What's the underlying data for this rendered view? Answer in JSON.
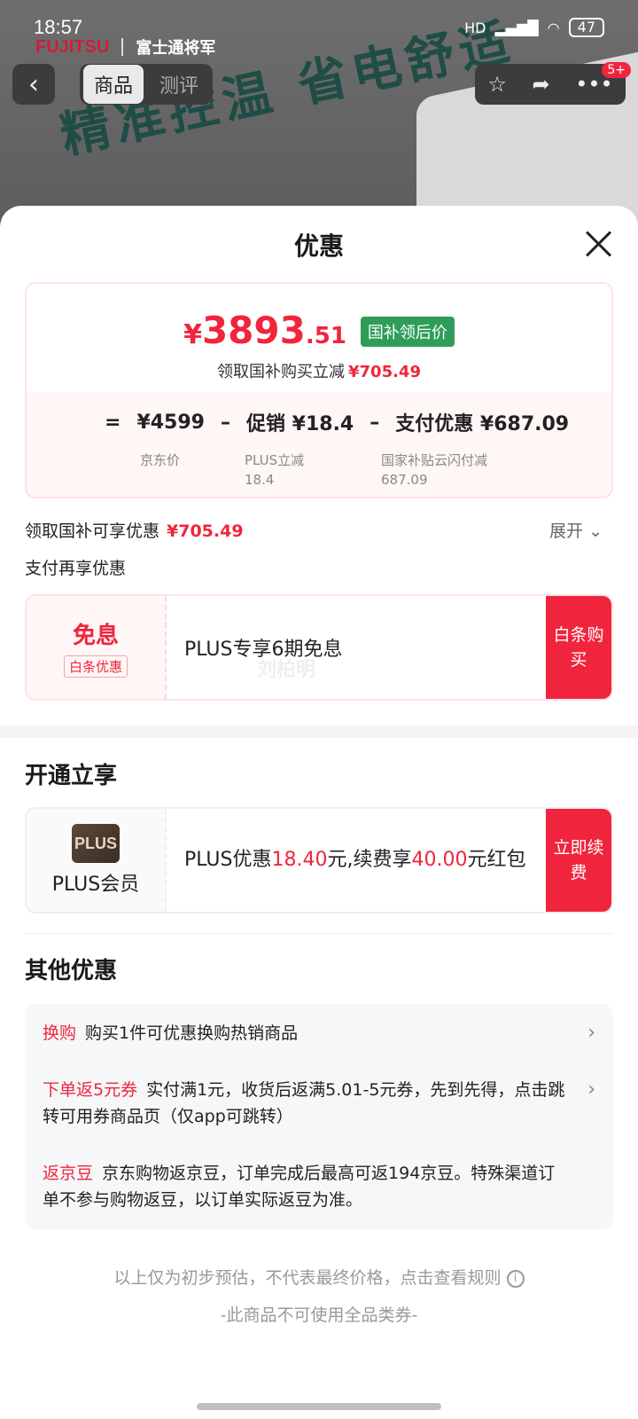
{
  "status_bar": {
    "time": "18:57",
    "network": "HD",
    "battery": "47"
  },
  "background": {
    "brand_logo": "FUJITSU",
    "brand_name": "富士通将军",
    "slogan": "精准控温 省电舒适",
    "tabs": [
      {
        "label": "商品"
      },
      {
        "label": "测评"
      }
    ],
    "badge": "5+",
    "icons": {
      "back": "chevron-left-icon",
      "favorite": "star-icon",
      "share": "share-icon",
      "more": "more-icon"
    }
  },
  "sheet": {
    "title": "优惠",
    "price": {
      "symbol": "¥",
      "integer": "3893",
      "decimal": ".51",
      "tag": "国补领后价",
      "sub_label": "领取国补购买立减",
      "sub_value": "¥705.49"
    },
    "calc": {
      "eq": "=",
      "base": "¥4599",
      "op1": "–",
      "promo_label": "促销 ¥18.4",
      "op2": "–",
      "pay_label": "支付优惠 ¥687.09",
      "base_sub": "京东价",
      "promo_sub1": "PLUS立减",
      "promo_sub2": "18.4",
      "pay_sub1": "国家补贴云闪付减",
      "pay_sub2": "687.09"
    },
    "claim_line": {
      "label": "领取国补可享优惠",
      "value": "¥705.49"
    },
    "expand_label": "展开",
    "pay_line": "支付再享优惠",
    "installment_card": {
      "title": "免息",
      "tag": "白条优惠",
      "text": "PLUS专享6期免息",
      "button": "白条购买",
      "watermark": "刘柏明"
    },
    "open_section_title": "开通立享",
    "plus_card": {
      "logo": "PLUS",
      "name": "PLUS会员",
      "text_a": "PLUS优惠",
      "amount_a": "18.40",
      "text_b": "元,续费享",
      "amount_b": "40.00",
      "text_c": "元红包",
      "button": "立即续费"
    },
    "other_section_title": "其他优惠",
    "other_items": [
      {
        "tag": "换购",
        "text": "购买1件可优惠换购热销商品"
      },
      {
        "tag": "下单返5元券",
        "text": "实付满1元，收货后返满5.01-5元券，先到先得，点击跳转可用券商品页（仅app可跳转）"
      },
      {
        "tag": "返京豆",
        "text": "京东购物返京豆，订单完成后最高可返194京豆。特殊渠道订单不参与购物返豆，以订单实际返豆为准。"
      }
    ],
    "footer_note": "以上仅为初步预估，不代表最终价格，点击查看规则",
    "footer_note2": "-此商品不可使用全品类券-"
  },
  "colors": {
    "accent": "#f0253d",
    "tag_green": "#2e9d5a"
  }
}
